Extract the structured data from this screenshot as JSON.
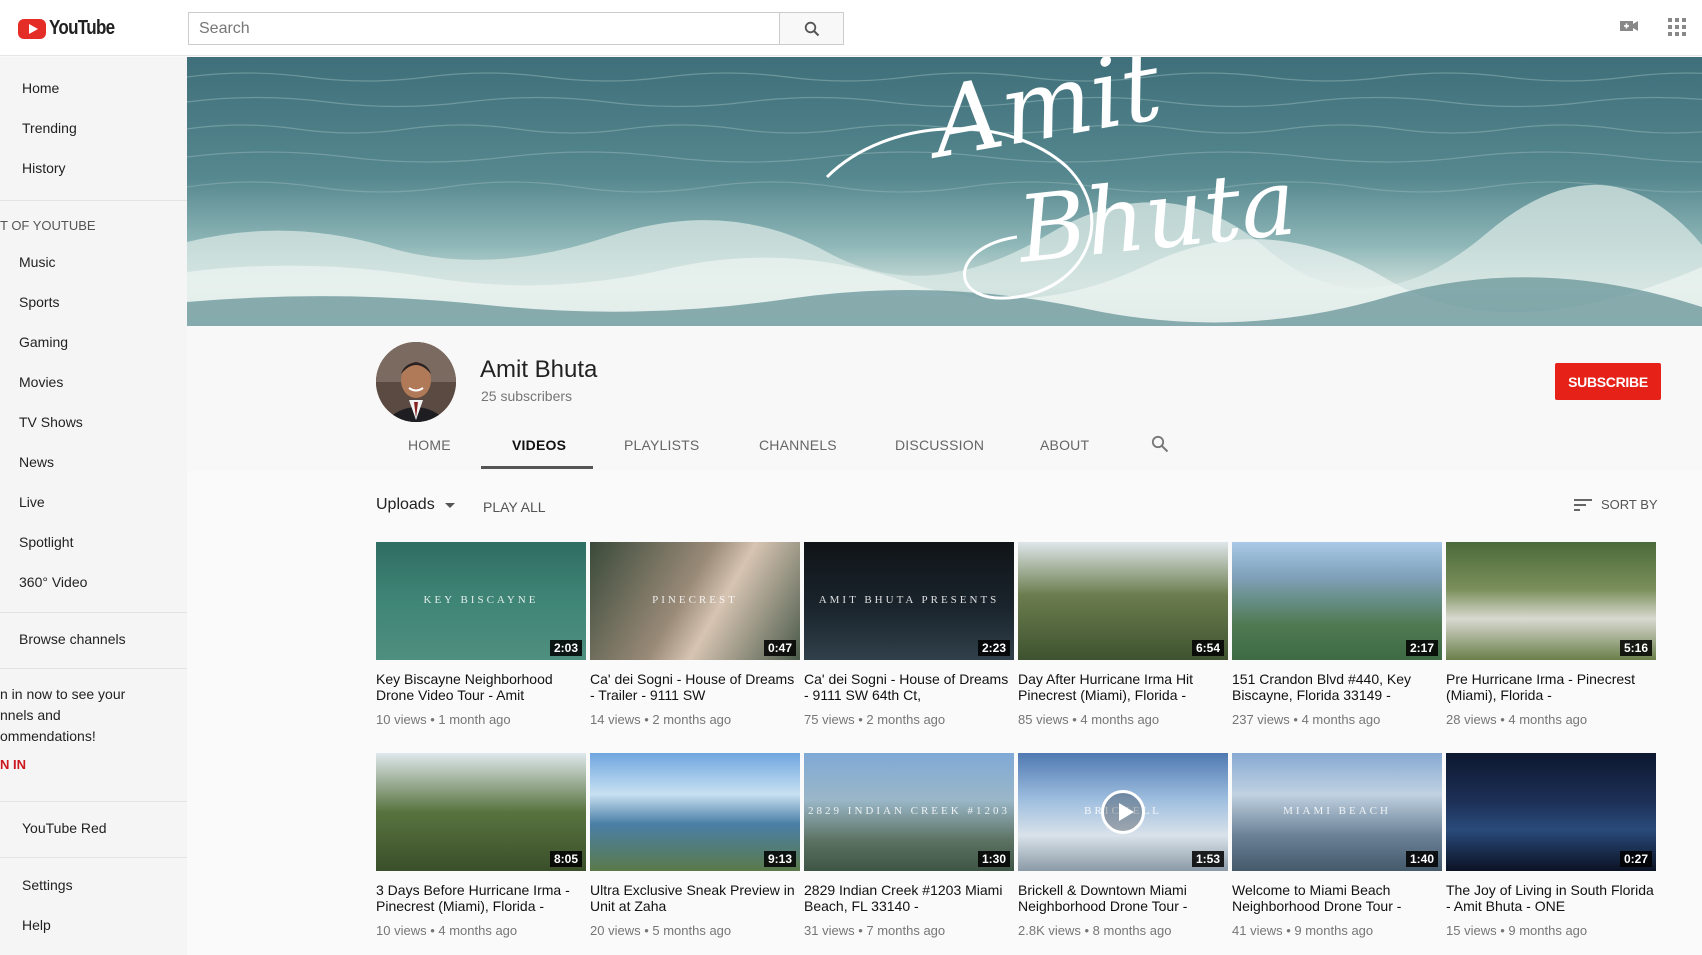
{
  "header": {
    "logo_text": "YouTube",
    "search_placeholder": "Search",
    "icons": [
      "search-icon",
      "upload-video-icon",
      "apps-grid-icon"
    ]
  },
  "sidebar": {
    "main": [
      "Home",
      "Trending",
      "History"
    ],
    "section_title": "T OF YOUTUBE",
    "best_of": [
      "Music",
      "Sports",
      "Gaming",
      "Movies",
      "TV Shows",
      "News",
      "Live",
      "Spotlight",
      "360° Video"
    ],
    "browse": "Browse channels",
    "signin_lines": [
      "n in now to see your",
      "nnels and",
      "ommendations!"
    ],
    "signin_label": "N IN",
    "red": "YouTube Red",
    "settings": "Settings",
    "help": "Help"
  },
  "banner": {
    "script_line1": "Amit",
    "script_line2": "Bhuta"
  },
  "channel": {
    "name": "Amit Bhuta",
    "subscribers": "25 subscribers",
    "subscribe_label": "SUBSCRIBE",
    "tabs": [
      "HOME",
      "VIDEOS",
      "PLAYLISTS",
      "CHANNELS",
      "DISCUSSION",
      "ABOUT"
    ],
    "active_tab": "VIDEOS"
  },
  "toolbar": {
    "uploads_label": "Uploads",
    "play_all_label": "PLAY ALL",
    "sort_by_label": "SORT BY"
  },
  "videos": [
    {
      "title": "Key Biscayne Neighborhood Drone Video Tour - Amit",
      "views": "10 views",
      "age": "1 month ago",
      "duration": "2:03",
      "overlay": "KEY BISCAYNE"
    },
    {
      "title": "Ca' dei Sogni - House of Dreams - Trailer - 9111 SW",
      "views": "14 views",
      "age": "2 months ago",
      "duration": "0:47",
      "overlay": "PINECREST"
    },
    {
      "title": "Ca' dei Sogni - House of Dreams - 9111 SW 64th Ct,",
      "views": "75 views",
      "age": "2 months ago",
      "duration": "2:23",
      "overlay": "AMIT BHUTA PRESENTS"
    },
    {
      "title": "Day After Hurricane Irma Hit Pinecrest (Miami), Florida -",
      "views": "85 views",
      "age": "4 months ago",
      "duration": "6:54",
      "overlay": ""
    },
    {
      "title": "151 Crandon Blvd #440, Key Biscayne, Florida 33149 -",
      "views": "237 views",
      "age": "4 months ago",
      "duration": "2:17",
      "overlay": ""
    },
    {
      "title": "Pre Hurricane Irma - Pinecrest (Miami), Florida -",
      "views": "28 views",
      "age": "4 months ago",
      "duration": "5:16",
      "overlay": ""
    },
    {
      "title": "3 Days Before Hurricane Irma - Pinecrest (Miami), Florida -",
      "views": "10 views",
      "age": "4 months ago",
      "duration": "8:05",
      "overlay": ""
    },
    {
      "title": "Ultra Exclusive Sneak Preview in Unit at Zaha",
      "views": "20 views",
      "age": "5 months ago",
      "duration": "9:13",
      "overlay": ""
    },
    {
      "title": "2829 Indian Creek #1203 Miami Beach, FL 33140 -",
      "views": "31 views",
      "age": "7 months ago",
      "duration": "1:30",
      "overlay": "2829 INDIAN CREEK #1203"
    },
    {
      "title": "Brickell & Downtown Miami Neighborhood Drone Tour -",
      "views": "2.8K views",
      "age": "8 months ago",
      "duration": "1:53",
      "overlay": "BRICKELL"
    },
    {
      "title": "Welcome to Miami Beach Neighborhood Drone Tour -",
      "views": "41 views",
      "age": "9 months ago",
      "duration": "1:40",
      "overlay": "MIAMI BEACH"
    },
    {
      "title": "The Joy of Living in South Florida - Amit Bhuta - ONE",
      "views": "15 views",
      "age": "9 months ago",
      "duration": "0:27",
      "overlay": ""
    }
  ],
  "colors": {
    "brand_red": "#e62117",
    "text_primary": "#111111",
    "text_secondary": "#767676",
    "sidebar_bg": "#f5f5f5"
  }
}
